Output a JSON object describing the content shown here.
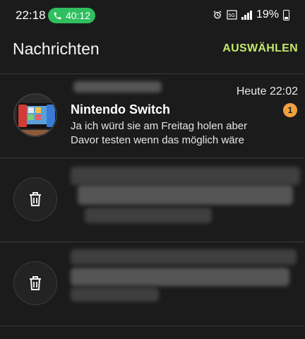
{
  "status_bar": {
    "time": "22:18",
    "call_timer": "40:12",
    "battery": "19%",
    "accent_call": "#2fbf5f"
  },
  "header": {
    "title": "Nachrichten",
    "action_label": "AUSWÄHLEN",
    "action_color": "#c6e66a"
  },
  "chats": [
    {
      "name": "Nintendo Switch",
      "time": "Heute 22:02",
      "snippet": "Ja ich würd sie am Freitag holen aber Davor testen wenn das möglich wäre",
      "unread": "1",
      "avatar": "product-photo"
    },
    {
      "avatar": "trash-icon",
      "redacted": true
    },
    {
      "avatar": "trash-icon",
      "redacted": true
    }
  ],
  "colors": {
    "background": "#1b1b1b",
    "badge": "#f0a040"
  }
}
